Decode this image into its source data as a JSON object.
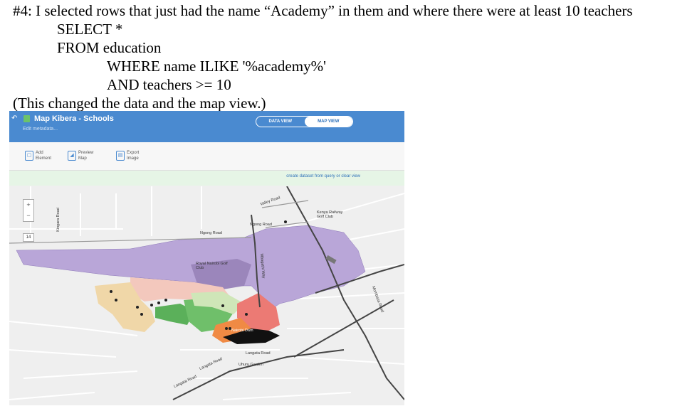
{
  "doc": {
    "line1": "#4: I selected rows that just had the name “Academy” in them and where there were at least 10 teachers",
    "line2": "SELECT *",
    "line3": "FROM education",
    "line4": "WHERE name ILIKE '%academy%'",
    "line5": "AND teachers >= 10",
    "line6": "(This changed the data and the map view.)"
  },
  "app": {
    "title": "Map Kibera - Schools",
    "subtitle": "Edit metadata...",
    "toggle": {
      "data_view": "DATA VIEW",
      "map_view": "MAP VIEW"
    },
    "toolbar": {
      "add": [
        "Add",
        "Element"
      ],
      "preview": [
        "Preview",
        "Map"
      ],
      "export": [
        "Export",
        "Image"
      ]
    },
    "info_link": "create dataset from query or clear view",
    "zoom": {
      "in": "+",
      "out": "−",
      "level": "14"
    }
  },
  "map_labels": {
    "valley_road": "Valley Road",
    "kenya_railway_golf": "Kenya Railway Golf Club",
    "ngong_road_1": "Ngong Road",
    "ngong_road_2": "Ngong Road",
    "kingara_road": "Kingara Road",
    "royal_nairobi_golf": "Royal Nairobi Golf Club",
    "mbagathi_way": "Mbagathi Way",
    "mombasa_road": "Mombasa Road",
    "nairobi_dam": "Nairobi Dam",
    "langata_road_1": "Langata Road",
    "langata_road_2": "Langata Road",
    "langata_road_3": "Langata Road",
    "uhuru_garden": "Uhuru Garden"
  },
  "colors": {
    "header_blue": "#4a8ad0",
    "purple": "#b9a6d8",
    "pink": "#f3c8bd",
    "tan": "#f0d7a8",
    "green": "#6fbf6a",
    "light_green": "#cfe6b8",
    "orange": "#f08a44",
    "red": "#ec7a74",
    "black": "#111111"
  }
}
